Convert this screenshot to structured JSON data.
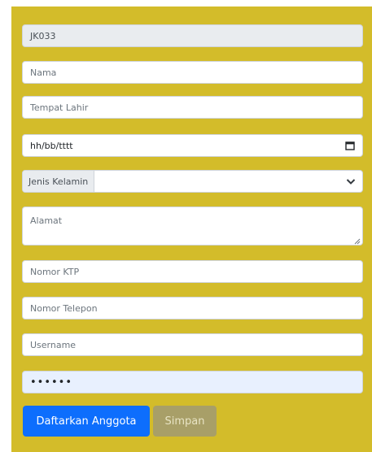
{
  "form": {
    "id_value": "JK033",
    "nama_placeholder": "Nama",
    "tempat_lahir_placeholder": "Tempat Lahir",
    "tanggal_lahir_placeholder": "hh/bb/tttt",
    "jenis_kelamin_label": "Jenis Kelamin",
    "jenis_kelamin_value": "",
    "alamat_placeholder": "Alamat",
    "nomor_ktp_placeholder": "Nomor KTP",
    "nomor_telepon_placeholder": "Nomor Telepon",
    "username_placeholder": "Username",
    "password_value": "••••••",
    "submit_label": "Daftarkan Anggota",
    "save_label": "Simpan"
  },
  "icons": {
    "date": "calendar-icon",
    "select": "chevron-down-icon",
    "resize": "resize-handle-icon"
  },
  "colors": {
    "panel": "#d3bc2a",
    "primary_button": "#0d6efd",
    "secondary_button": "#a89f68",
    "autofill": "#e8f0fe"
  }
}
